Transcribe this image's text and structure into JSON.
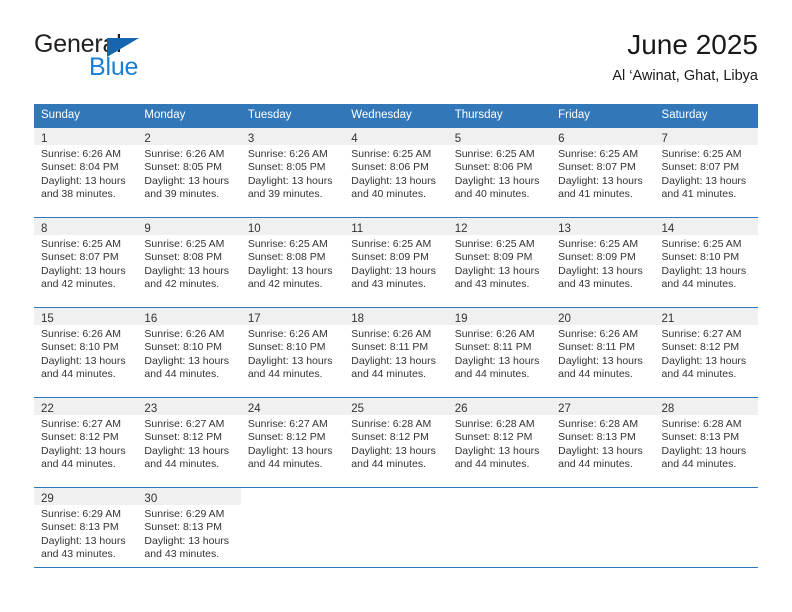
{
  "logo": {
    "word_top": "General",
    "word_bottom": "Blue",
    "flag_icon": "triangle-flag-icon",
    "blue": "#1a7fd4",
    "flag_blue": "#1565b0"
  },
  "header": {
    "title": "June 2025",
    "subtitle": "Al ‘Awinat, Ghat, Libya"
  },
  "theme": {
    "header_blue": "#3277b8",
    "daynum_band": "#f0f0f0",
    "text": "#333333"
  },
  "weekdays": [
    "Sunday",
    "Monday",
    "Tuesday",
    "Wednesday",
    "Thursday",
    "Friday",
    "Saturday"
  ],
  "weeks": [
    [
      {
        "day": "1",
        "sunrise": "Sunrise: 6:26 AM",
        "sunset": "Sunset: 8:04 PM",
        "daylight": "Daylight: 13 hours and 38 minutes."
      },
      {
        "day": "2",
        "sunrise": "Sunrise: 6:26 AM",
        "sunset": "Sunset: 8:05 PM",
        "daylight": "Daylight: 13 hours and 39 minutes."
      },
      {
        "day": "3",
        "sunrise": "Sunrise: 6:26 AM",
        "sunset": "Sunset: 8:05 PM",
        "daylight": "Daylight: 13 hours and 39 minutes."
      },
      {
        "day": "4",
        "sunrise": "Sunrise: 6:25 AM",
        "sunset": "Sunset: 8:06 PM",
        "daylight": "Daylight: 13 hours and 40 minutes."
      },
      {
        "day": "5",
        "sunrise": "Sunrise: 6:25 AM",
        "sunset": "Sunset: 8:06 PM",
        "daylight": "Daylight: 13 hours and 40 minutes."
      },
      {
        "day": "6",
        "sunrise": "Sunrise: 6:25 AM",
        "sunset": "Sunset: 8:07 PM",
        "daylight": "Daylight: 13 hours and 41 minutes."
      },
      {
        "day": "7",
        "sunrise": "Sunrise: 6:25 AM",
        "sunset": "Sunset: 8:07 PM",
        "daylight": "Daylight: 13 hours and 41 minutes."
      }
    ],
    [
      {
        "day": "8",
        "sunrise": "Sunrise: 6:25 AM",
        "sunset": "Sunset: 8:07 PM",
        "daylight": "Daylight: 13 hours and 42 minutes."
      },
      {
        "day": "9",
        "sunrise": "Sunrise: 6:25 AM",
        "sunset": "Sunset: 8:08 PM",
        "daylight": "Daylight: 13 hours and 42 minutes."
      },
      {
        "day": "10",
        "sunrise": "Sunrise: 6:25 AM",
        "sunset": "Sunset: 8:08 PM",
        "daylight": "Daylight: 13 hours and 42 minutes."
      },
      {
        "day": "11",
        "sunrise": "Sunrise: 6:25 AM",
        "sunset": "Sunset: 8:09 PM",
        "daylight": "Daylight: 13 hours and 43 minutes."
      },
      {
        "day": "12",
        "sunrise": "Sunrise: 6:25 AM",
        "sunset": "Sunset: 8:09 PM",
        "daylight": "Daylight: 13 hours and 43 minutes."
      },
      {
        "day": "13",
        "sunrise": "Sunrise: 6:25 AM",
        "sunset": "Sunset: 8:09 PM",
        "daylight": "Daylight: 13 hours and 43 minutes."
      },
      {
        "day": "14",
        "sunrise": "Sunrise: 6:25 AM",
        "sunset": "Sunset: 8:10 PM",
        "daylight": "Daylight: 13 hours and 44 minutes."
      }
    ],
    [
      {
        "day": "15",
        "sunrise": "Sunrise: 6:26 AM",
        "sunset": "Sunset: 8:10 PM",
        "daylight": "Daylight: 13 hours and 44 minutes."
      },
      {
        "day": "16",
        "sunrise": "Sunrise: 6:26 AM",
        "sunset": "Sunset: 8:10 PM",
        "daylight": "Daylight: 13 hours and 44 minutes."
      },
      {
        "day": "17",
        "sunrise": "Sunrise: 6:26 AM",
        "sunset": "Sunset: 8:10 PM",
        "daylight": "Daylight: 13 hours and 44 minutes."
      },
      {
        "day": "18",
        "sunrise": "Sunrise: 6:26 AM",
        "sunset": "Sunset: 8:11 PM",
        "daylight": "Daylight: 13 hours and 44 minutes."
      },
      {
        "day": "19",
        "sunrise": "Sunrise: 6:26 AM",
        "sunset": "Sunset: 8:11 PM",
        "daylight": "Daylight: 13 hours and 44 minutes."
      },
      {
        "day": "20",
        "sunrise": "Sunrise: 6:26 AM",
        "sunset": "Sunset: 8:11 PM",
        "daylight": "Daylight: 13 hours and 44 minutes."
      },
      {
        "day": "21",
        "sunrise": "Sunrise: 6:27 AM",
        "sunset": "Sunset: 8:12 PM",
        "daylight": "Daylight: 13 hours and 44 minutes."
      }
    ],
    [
      {
        "day": "22",
        "sunrise": "Sunrise: 6:27 AM",
        "sunset": "Sunset: 8:12 PM",
        "daylight": "Daylight: 13 hours and 44 minutes."
      },
      {
        "day": "23",
        "sunrise": "Sunrise: 6:27 AM",
        "sunset": "Sunset: 8:12 PM",
        "daylight": "Daylight: 13 hours and 44 minutes."
      },
      {
        "day": "24",
        "sunrise": "Sunrise: 6:27 AM",
        "sunset": "Sunset: 8:12 PM",
        "daylight": "Daylight: 13 hours and 44 minutes."
      },
      {
        "day": "25",
        "sunrise": "Sunrise: 6:28 AM",
        "sunset": "Sunset: 8:12 PM",
        "daylight": "Daylight: 13 hours and 44 minutes."
      },
      {
        "day": "26",
        "sunrise": "Sunrise: 6:28 AM",
        "sunset": "Sunset: 8:12 PM",
        "daylight": "Daylight: 13 hours and 44 minutes."
      },
      {
        "day": "27",
        "sunrise": "Sunrise: 6:28 AM",
        "sunset": "Sunset: 8:13 PM",
        "daylight": "Daylight: 13 hours and 44 minutes."
      },
      {
        "day": "28",
        "sunrise": "Sunrise: 6:28 AM",
        "sunset": "Sunset: 8:13 PM",
        "daylight": "Daylight: 13 hours and 44 minutes."
      }
    ],
    [
      {
        "day": "29",
        "sunrise": "Sunrise: 6:29 AM",
        "sunset": "Sunset: 8:13 PM",
        "daylight": "Daylight: 13 hours and 43 minutes."
      },
      {
        "day": "30",
        "sunrise": "Sunrise: 6:29 AM",
        "sunset": "Sunset: 8:13 PM",
        "daylight": "Daylight: 13 hours and 43 minutes."
      },
      {
        "day": "",
        "sunrise": "",
        "sunset": "",
        "daylight": ""
      },
      {
        "day": "",
        "sunrise": "",
        "sunset": "",
        "daylight": ""
      },
      {
        "day": "",
        "sunrise": "",
        "sunset": "",
        "daylight": ""
      },
      {
        "day": "",
        "sunrise": "",
        "sunset": "",
        "daylight": ""
      },
      {
        "day": "",
        "sunrise": "",
        "sunset": "",
        "daylight": ""
      }
    ]
  ]
}
